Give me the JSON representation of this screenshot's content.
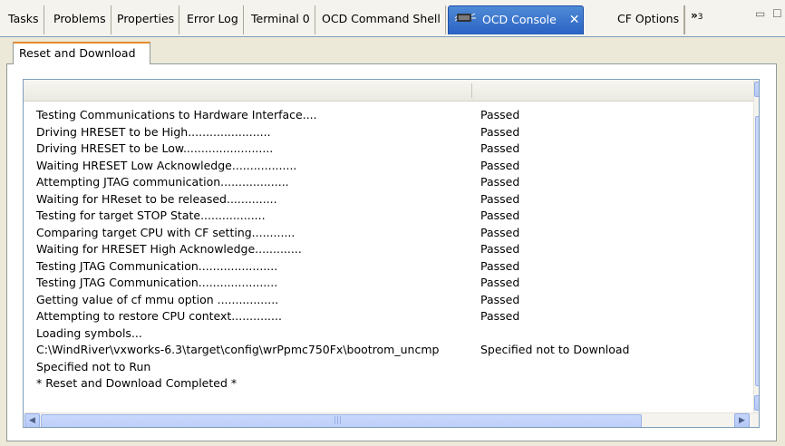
{
  "tabs": [
    {
      "label": "Tasks"
    },
    {
      "label": "Problems"
    },
    {
      "label": "Properties"
    },
    {
      "label": "Error Log"
    },
    {
      "label": "Terminal 0"
    },
    {
      "label": "OCD Command Shell"
    },
    {
      "label": "OCD Console",
      "active": true
    },
    {
      "label": "CF Options"
    }
  ],
  "overflow": {
    "chevron": "»",
    "count": "3"
  },
  "subtab": {
    "label": "Reset and Download"
  },
  "rows": [
    {
      "step": "Testing Communications to Hardware Interface....",
      "status": "Passed"
    },
    {
      "step": "Driving HRESET to be High.......................",
      "status": "Passed"
    },
    {
      "step": "Driving HRESET to be Low.........................",
      "status": "Passed"
    },
    {
      "step": "Waiting HRESET Low Acknowledge..................",
      "status": "Passed"
    },
    {
      "step": "Attempting JTAG communication...................",
      "status": "Passed"
    },
    {
      "step": "Waiting for HReset to be released..............",
      "status": "Passed"
    },
    {
      "step": "Testing for target STOP State..................",
      "status": "Passed"
    },
    {
      "step": "Comparing target CPU with CF setting............",
      "status": "Passed"
    },
    {
      "step": "Waiting for HRESET High Acknowledge.............",
      "status": "Passed"
    },
    {
      "step": "Testing JTAG Communication......................",
      "status": "Passed"
    },
    {
      "step": "Testing JTAG Communication......................",
      "status": "Passed"
    },
    {
      "step": "Getting value of cf mmu option .................",
      "status": "Passed"
    },
    {
      "step": "Attempting to restore CPU context..............",
      "status": "Passed"
    },
    {
      "step": "Loading symbols...",
      "status": ""
    },
    {
      "step": "C:\\WindRiver\\vxworks-6.3\\target\\config\\wrPpmc750Fx\\bootrom_uncmp",
      "status": "Specified not to Download"
    },
    {
      "step": "Specified not to Run",
      "status": ""
    },
    {
      "step": "* Reset and Download Completed *",
      "status": ""
    }
  ],
  "icons": {
    "close": "close-icon",
    "console": "ocd-console-icon",
    "up": "arrow-up-icon",
    "down": "arrow-down-icon",
    "left": "arrow-left-icon",
    "right": "arrow-right-icon",
    "minimize": "minimize-icon",
    "maximize": "maximize-icon"
  }
}
